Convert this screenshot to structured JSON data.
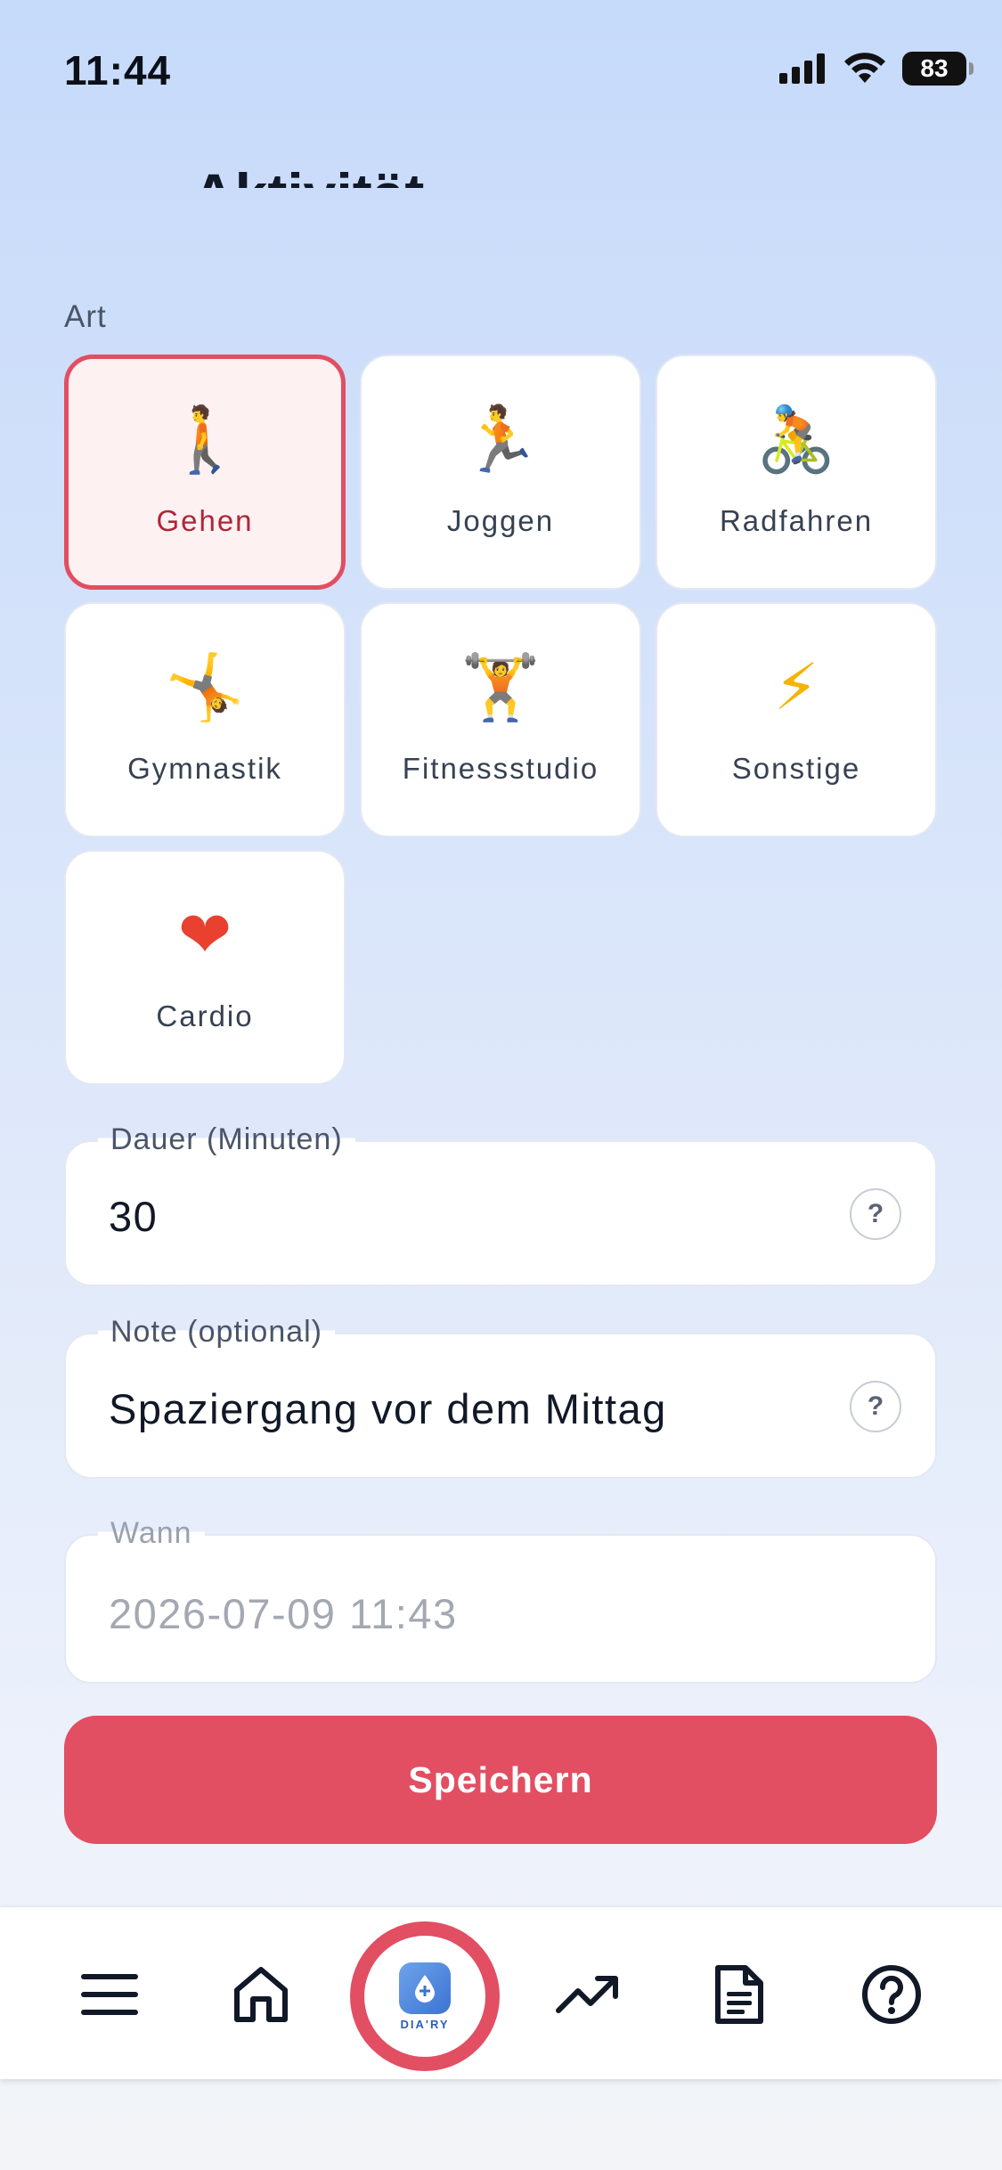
{
  "status_bar": {
    "time": "11:44",
    "battery": "83"
  },
  "header": {
    "title": "Aktivität"
  },
  "activity": {
    "section_label": "Art",
    "types": [
      {
        "label": "Gehen",
        "emoji": "🚶",
        "selected": true
      },
      {
        "label": "Joggen",
        "emoji": "🏃",
        "selected": false
      },
      {
        "label": "Radfahren",
        "emoji": "🚴",
        "selected": false
      },
      {
        "label": "Gymnastik",
        "emoji": "🤸",
        "selected": false
      },
      {
        "label": "Fitnessstudio",
        "emoji": "🏋",
        "selected": false
      },
      {
        "label": "Sonstige",
        "emoji": "⚡",
        "selected": false
      },
      {
        "label": "Cardio",
        "emoji": "❤",
        "selected": false
      }
    ]
  },
  "duration": {
    "label": "Dauer (Minuten)",
    "value": "30",
    "help": "?"
  },
  "note": {
    "label": "Note (optional)",
    "value": "Spaziergang vor dem Mittag",
    "help": "?"
  },
  "when": {
    "label": "Wann",
    "value": "2026-07-09  11:43"
  },
  "save_button": {
    "label": "Speichern"
  },
  "nav": {
    "items": [
      "menu-icon",
      "home-icon",
      "app-logo",
      "trend-icon",
      "document-icon",
      "help-icon"
    ],
    "logo_text": "DIA'RY"
  },
  "colors": {
    "accent": "#e24e62",
    "selected_bg": "#fef1f2",
    "background_top": "#c6dafa"
  }
}
